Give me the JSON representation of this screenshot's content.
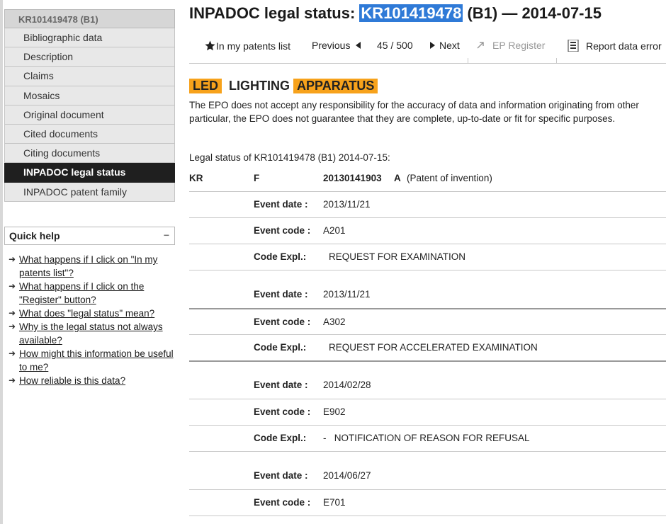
{
  "sidebar": {
    "header": "KR101419478 (B1)",
    "items": [
      {
        "label": "Bibliographic data"
      },
      {
        "label": "Description"
      },
      {
        "label": "Claims"
      },
      {
        "label": "Mosaics"
      },
      {
        "label": "Original document"
      },
      {
        "label": "Cited documents"
      },
      {
        "label": "Citing documents"
      },
      {
        "label": "INPADOC legal status",
        "active": true
      },
      {
        "label": "INPADOC patent family"
      }
    ]
  },
  "quick_help": {
    "title": "Quick help",
    "collapse": "−",
    "links": [
      "What happens if I click on \"In my patents list\"?",
      "What happens if I click on the \"Register\" button?",
      "What does \"legal status\" mean?",
      "Why is the legal status not always available?",
      "How might this information be useful to me?",
      "How reliable is this data?"
    ]
  },
  "title": {
    "prefix": "INPADOC legal status: ",
    "number": "KR101419478",
    "suffix": " (B1) — 2014-07-15"
  },
  "toolbar": {
    "patents_list": "In my patents list",
    "previous": "Previous",
    "position": "45 / 500",
    "next": "Next",
    "ep_register": "EP Register",
    "report": "Report data error"
  },
  "headline": {
    "word1": "LED",
    "word2": "LIGHTING",
    "word3": "APPARATUS"
  },
  "disclaimer": {
    "line1": "The EPO does not accept any responsibility for the accuracy of data and information originating from other",
    "line2": "particular, the EPO does not guarantee that they are complete, up-to-date or fit for specific purposes."
  },
  "legal_status": {
    "heading": "Legal status of KR101419478 (B1) 2014-07-15:",
    "country": "KR",
    "kind": "F",
    "app_number": "20130141903",
    "app_kind": "A",
    "app_desc": "(Patent of invention)",
    "labels": {
      "event_date": "Event date :",
      "event_code": "Event code :",
      "code_expl": "Code Expl.:"
    },
    "events": [
      {
        "date": "2013/11/21",
        "code": "A201",
        "expl": "REQUEST FOR EXAMINATION"
      },
      {
        "date": "2013/11/21",
        "code": "A302",
        "expl": "REQUEST FOR ACCELERATED EXAMINATION"
      },
      {
        "date": "2014/02/28",
        "code": "E902",
        "expl": "-   NOTIFICATION OF REASON FOR REFUSAL"
      },
      {
        "date": "2014/06/27",
        "code": "E701",
        "expl": ""
      }
    ]
  }
}
